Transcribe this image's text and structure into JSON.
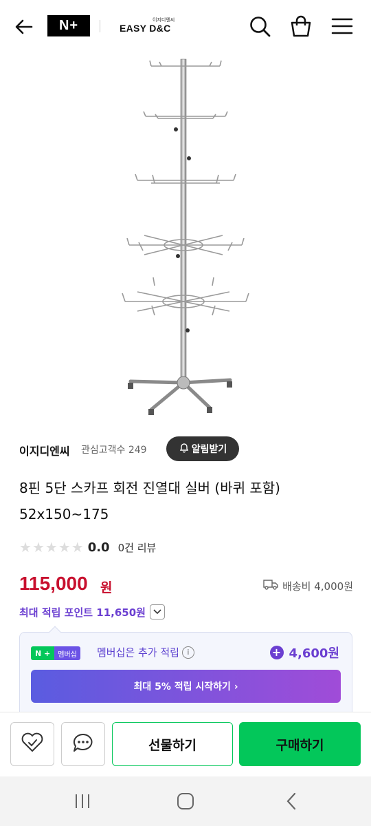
{
  "header": {
    "logo_text": "N+",
    "brand_small": "이지디엔씨",
    "brand_name": "EASY D&C",
    "icons": [
      "back-arrow-icon",
      "search-icon",
      "shopping-bag-icon",
      "menu-icon"
    ]
  },
  "seller": {
    "name": "이지디엔씨",
    "fans": "관심고객수 249",
    "alarm_label": "알림받기"
  },
  "product": {
    "title": "8핀 5단 스카프 회전 진열대 실버 (바퀴 포함) 52x150~175",
    "rating": "0.0",
    "star_count": 5,
    "review_count": "0건 리뷰",
    "price": "115,000",
    "price_unit": "원",
    "shipping": "배송비 4,000원",
    "max_points": "최대 적립 포인트 11,650원"
  },
  "membership": {
    "badge_np": "N +",
    "badge_label": "멤버십",
    "text": "멤버십은 추가 적립",
    "points": "4,600원",
    "cta": "최대 5% 적립 시작하기 ›"
  },
  "bottom_bar": {
    "gift_label": "선물하기",
    "buy_label": "구매하기"
  },
  "colors": {
    "price": "#c8102e",
    "points": "#6b3fd1",
    "naver_green": "#03c75a"
  }
}
